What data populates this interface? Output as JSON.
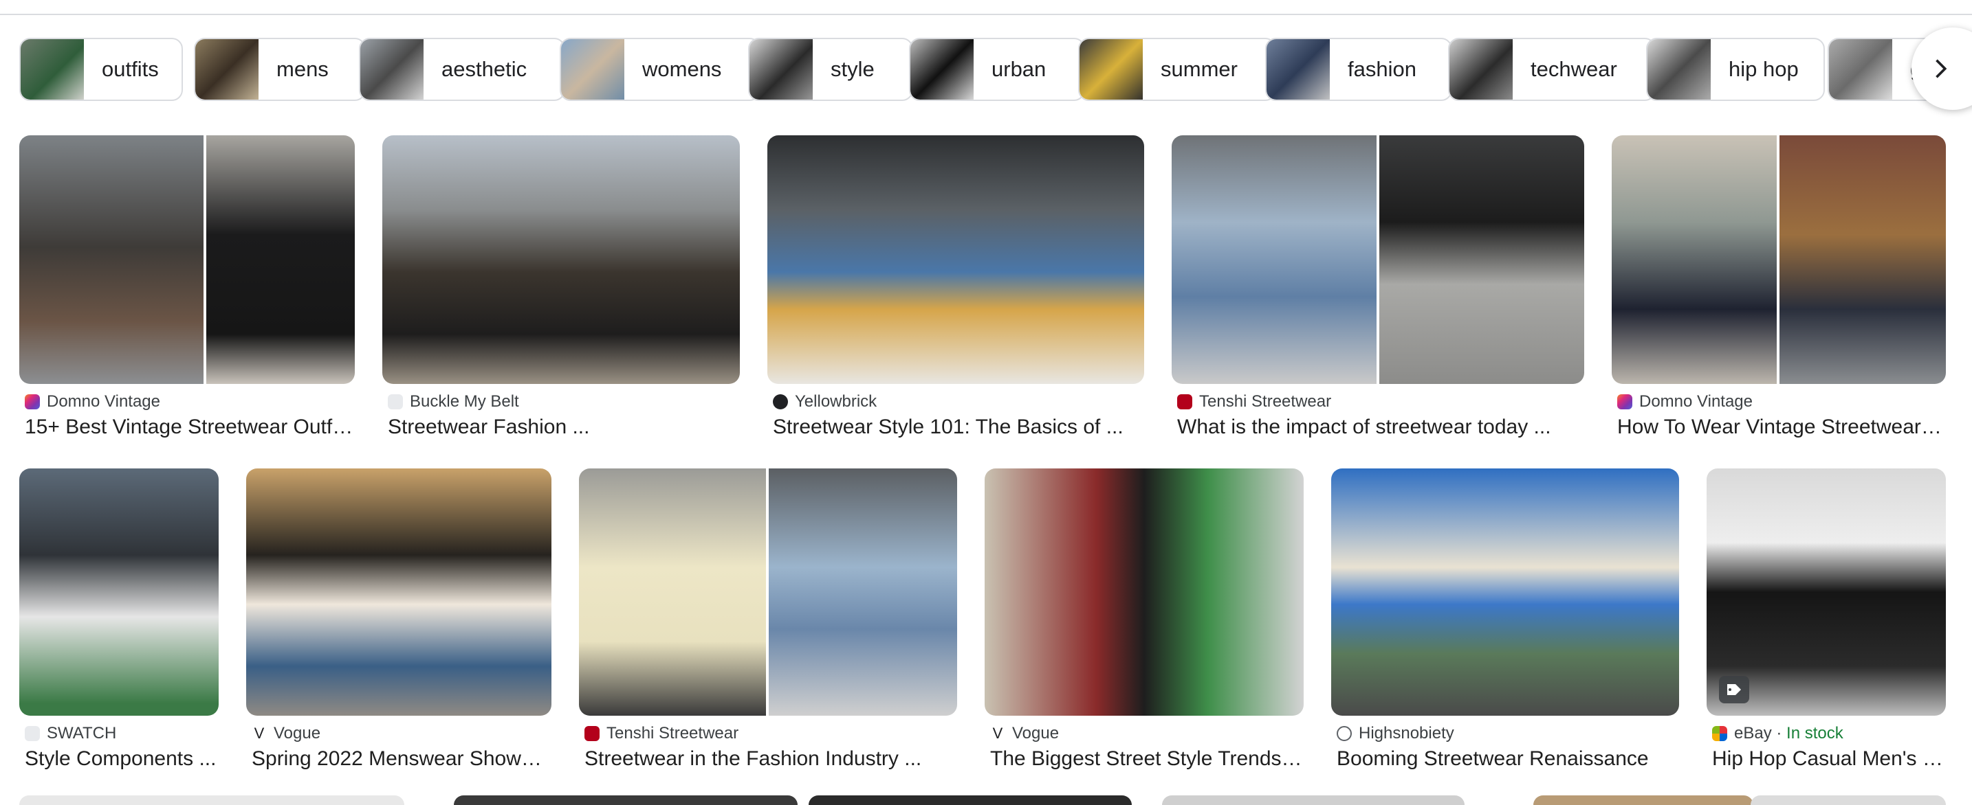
{
  "chips": [
    {
      "label": "outfits"
    },
    {
      "label": "mens"
    },
    {
      "label": "aesthetic"
    },
    {
      "label": "womens"
    },
    {
      "label": "style"
    },
    {
      "label": "urban"
    },
    {
      "label": "summer"
    },
    {
      "label": "fashion"
    },
    {
      "label": "techwear"
    },
    {
      "label": "hip hop"
    },
    {
      "label": "g"
    }
  ],
  "results_row1": [
    {
      "source": "Domno Vintage",
      "title": "15+ Best Vintage Streetwear Outfit..."
    },
    {
      "source": "Buckle My Belt",
      "title": "Streetwear Fashion ..."
    },
    {
      "source": "Yellowbrick",
      "title": "Streetwear Style 101: The Basics of ..."
    },
    {
      "source": "Tenshi Streetwear",
      "title": "What is the impact of streetwear today ..."
    },
    {
      "source": "Domno Vintage",
      "title": "How To Wear Vintage Streetwear I..."
    }
  ],
  "results_row2": [
    {
      "source": "SWATCH",
      "title": "Style Components ..."
    },
    {
      "source": "Vogue",
      "title": "Spring 2022 Menswear Shows i..."
    },
    {
      "source": "Tenshi Streetwear",
      "title": "Streetwear in the Fashion Industry ..."
    },
    {
      "source": "Vogue",
      "title": "The Biggest Street Style Trends o..."
    },
    {
      "source": "Highsnobiety",
      "title": "Booming Streetwear Renaissance"
    },
    {
      "source": "eBay",
      "source_separator": " · ",
      "stock": "In stock",
      "title": "Hip Hop Casual Men's S..."
    }
  ],
  "icons": {
    "next": "chevron-right-icon",
    "shopping_tag": "tag-icon"
  }
}
